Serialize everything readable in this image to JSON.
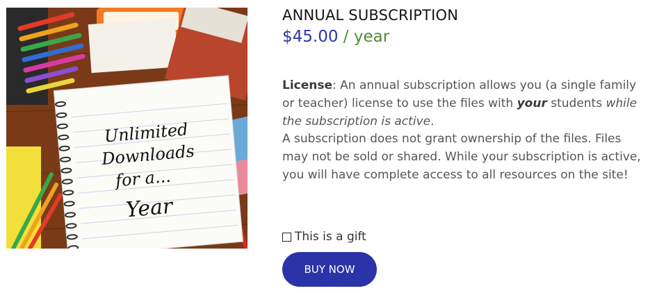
{
  "product": {
    "title": "ANNUAL SUBSCRIPTION",
    "price": "$45.00",
    "period": "/ year",
    "image": {
      "handwriting": [
        "Unlimited",
        "Downloads",
        "for a...",
        "Year"
      ]
    }
  },
  "description": {
    "license_label": "License",
    "license_text_1": ": An annual subscription allows you (a single family or teacher) license to use the files with ",
    "license_emphasis": "your",
    "license_text_2": " students ",
    "license_italic": "while the subscription is active",
    "license_text_3": ".",
    "ownership_text": "A subscription does not grant ownership of the files. Files may not be sold or shared. While your subscription is active, you will have complete access to all resources on the site!"
  },
  "gift": {
    "label": "This is a gift",
    "checked": false
  },
  "buy_button": {
    "label": "BUY NOW"
  },
  "colors": {
    "price": "#2b36a8",
    "period": "#4f8a36",
    "button": "#2b33a8"
  }
}
